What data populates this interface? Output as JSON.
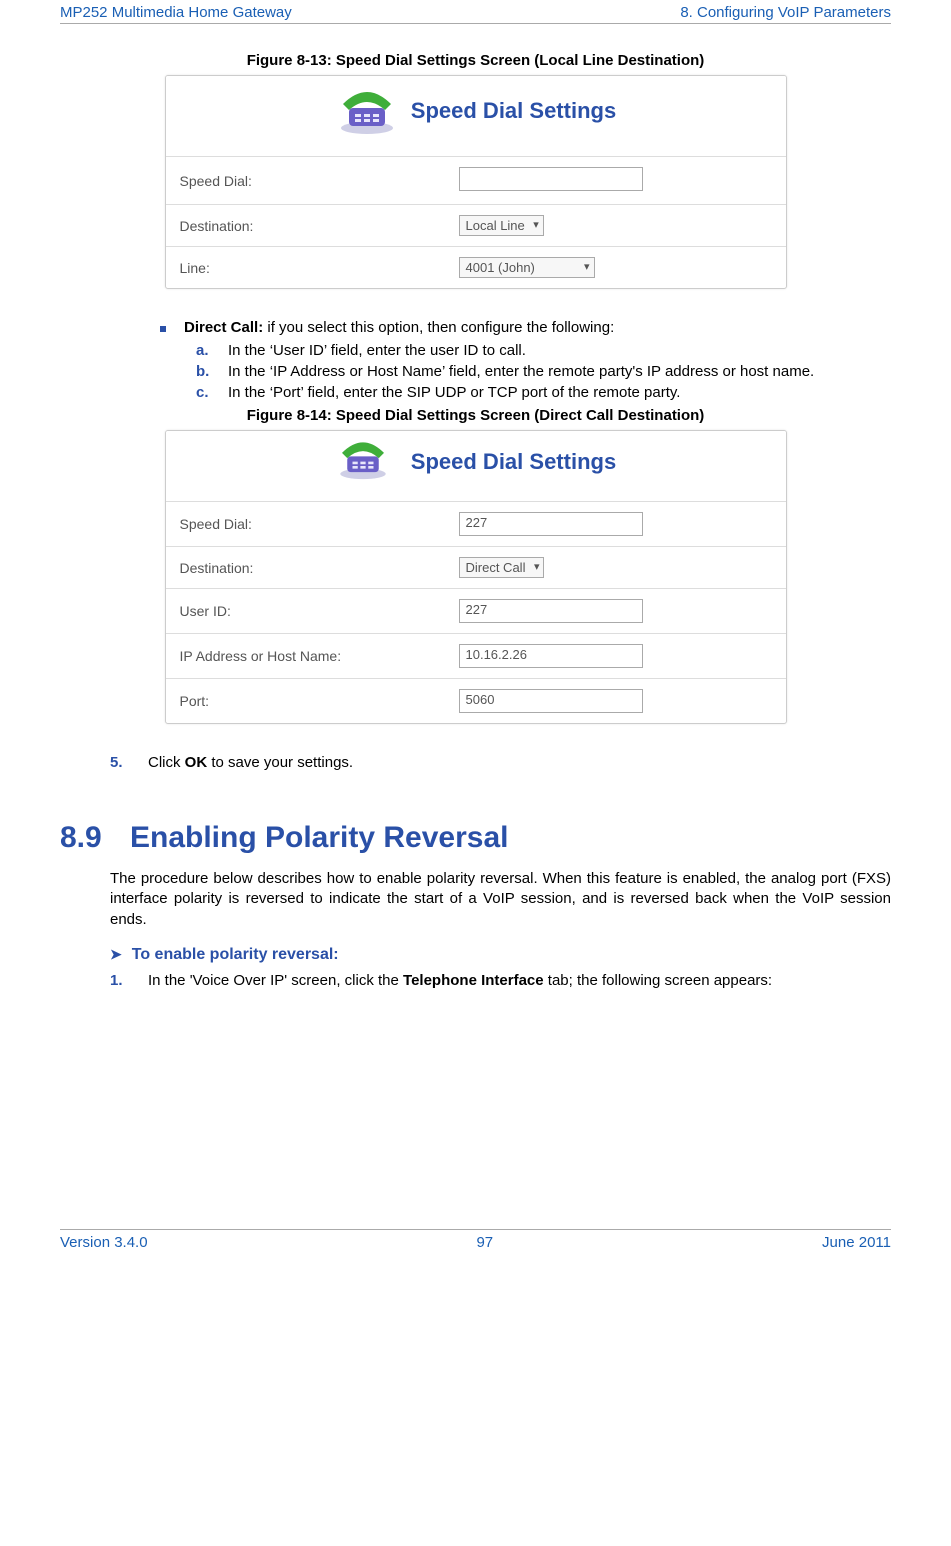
{
  "header": {
    "left": "MP252 Multimedia Home Gateway",
    "right": "8. Configuring VoIP Parameters"
  },
  "fig813": {
    "caption": "Figure 8-13: Speed Dial Settings Screen (Local Line Destination)",
    "title": "Speed Dial Settings",
    "rows": {
      "speed_dial": {
        "label": "Speed Dial:",
        "value": ""
      },
      "destination": {
        "label": "Destination:",
        "value": "Local Line"
      },
      "line": {
        "label": "Line:",
        "value": "4001 (John)"
      }
    }
  },
  "direct_call": {
    "lead": "Direct Call:",
    "lead_rest": " if you select this option, then configure the following:",
    "a": "In the ‘User ID’ field, enter the user ID to call.",
    "b": "In the ‘IP Address or Host Name’ field, enter the remote party's IP address or host name.",
    "c": "In the ‘Port’ field, enter the SIP UDP or TCP port of the remote party."
  },
  "fig814": {
    "caption": "Figure 8-14: Speed Dial Settings Screen (Direct Call Destination)",
    "title": "Speed Dial Settings",
    "rows": {
      "speed_dial": {
        "label": "Speed Dial:",
        "value": "227"
      },
      "destination": {
        "label": "Destination:",
        "value": "Direct Call"
      },
      "user_id": {
        "label": "User ID:",
        "value": "227"
      },
      "ip": {
        "label": "IP Address or Host Name:",
        "value": "10.16.2.26"
      },
      "port": {
        "label": "Port:",
        "value": "5060"
      }
    }
  },
  "step5": {
    "num": "5.",
    "pre": "Click ",
    "bold": "OK",
    "post": " to save your settings."
  },
  "section89": {
    "num": "8.9",
    "title": "Enabling Polarity Reversal",
    "para": "The procedure below describes how to enable polarity reversal. When this feature is enabled, the analog port (FXS) interface polarity is reversed to indicate the start of a VoIP session, and is reversed back when the VoIP session ends.",
    "proc": "To enable polarity reversal:",
    "step1": {
      "num": "1.",
      "pre": "In the 'Voice Over IP' screen, click the ",
      "bold": "Telephone Interface",
      "post": " tab; the following screen appears:"
    }
  },
  "footer": {
    "left": "Version 3.4.0",
    "center": "97",
    "right": "June 2011"
  }
}
